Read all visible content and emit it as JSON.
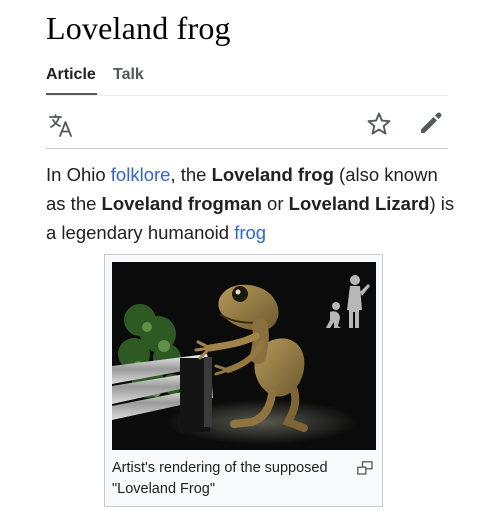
{
  "page": {
    "title": "Loveland frog"
  },
  "tabs": [
    {
      "label": "Article",
      "active": true
    },
    {
      "label": "Talk",
      "active": false
    }
  ],
  "toolbar": {
    "icons": [
      "language-icon",
      "star-icon",
      "edit-icon"
    ]
  },
  "intro": {
    "t1": "In Ohio ",
    "link1": "folklore",
    "t2": ", the ",
    "b1": "Loveland frog",
    "t3": " (also known as the ",
    "b2": "Loveland frogman",
    "t4": " or ",
    "b3": "Loveland Lizard",
    "t5": ") is a legendary humanoid ",
    "link2": "frog"
  },
  "figure": {
    "caption": "Artist's rendering of the supposed \"Loveland Frog\"",
    "enlarge_icon": "enlarge-icon"
  },
  "colors": {
    "link": "#3366cc",
    "text": "#202122",
    "tab_inactive": "#54595d",
    "border": "#c8ccd1"
  }
}
